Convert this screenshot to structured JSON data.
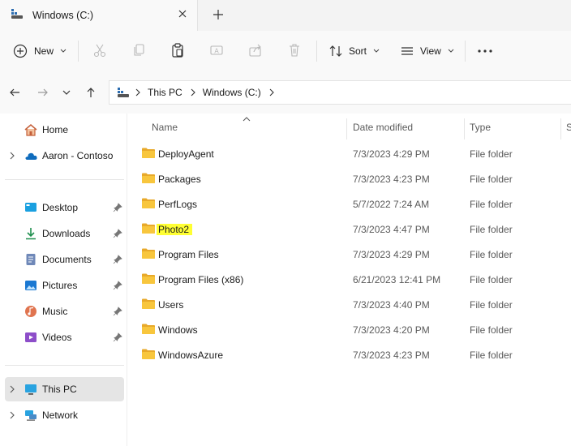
{
  "tab": {
    "title": "Windows (C:)"
  },
  "toolbar": {
    "new_label": "New",
    "sort_label": "Sort",
    "view_label": "View",
    "more_label": "···"
  },
  "address": {
    "segments": [
      "This PC",
      "Windows (C:)"
    ]
  },
  "sidebar": {
    "items": [
      {
        "label": "Home",
        "icon": "home-icon"
      },
      {
        "label": "Aaron - Contoso",
        "icon": "onedrive-icon"
      },
      {
        "label": "Desktop",
        "icon": "desktop-icon"
      },
      {
        "label": "Downloads",
        "icon": "downloads-icon"
      },
      {
        "label": "Documents",
        "icon": "documents-icon"
      },
      {
        "label": "Pictures",
        "icon": "pictures-icon"
      },
      {
        "label": "Music",
        "icon": "music-icon"
      },
      {
        "label": "Videos",
        "icon": "videos-icon"
      },
      {
        "label": "This PC",
        "icon": "this-pc-icon"
      },
      {
        "label": "Network",
        "icon": "network-icon"
      }
    ]
  },
  "columns": {
    "name": "Name",
    "date": "Date modified",
    "type": "Type",
    "size": "S"
  },
  "files": [
    {
      "name": "DeployAgent",
      "date": "7/3/2023 4:29 PM",
      "type": "File folder"
    },
    {
      "name": "Packages",
      "date": "7/3/2023 4:23 PM",
      "type": "File folder"
    },
    {
      "name": "PerfLogs",
      "date": "5/7/2022 7:24 AM",
      "type": "File folder"
    },
    {
      "name": "Photo2",
      "date": "7/3/2023 4:47 PM",
      "type": "File folder"
    },
    {
      "name": "Program Files",
      "date": "7/3/2023 4:29 PM",
      "type": "File folder"
    },
    {
      "name": "Program Files (x86)",
      "date": "6/21/2023 12:41 PM",
      "type": "File folder"
    },
    {
      "name": "Users",
      "date": "7/3/2023 4:40 PM",
      "type": "File folder"
    },
    {
      "name": "Windows",
      "date": "7/3/2023 4:20 PM",
      "type": "File folder"
    },
    {
      "name": "WindowsAzure",
      "date": "7/3/2023 4:23 PM",
      "type": "File folder"
    }
  ],
  "colors": {
    "folder": "#f8c63d",
    "highlight": "#ffff33",
    "accent": "#0067c0"
  }
}
